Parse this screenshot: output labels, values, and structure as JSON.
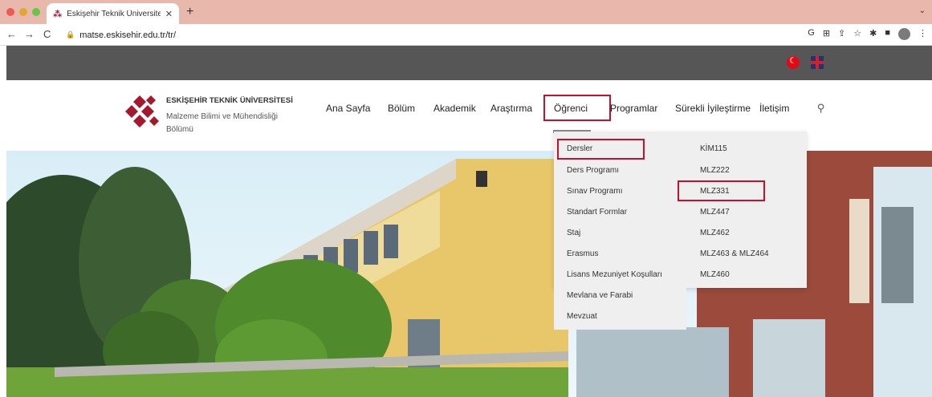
{
  "browser": {
    "tab_title": "Eskişehir Teknik Üniversitesi -",
    "url": "matse.eskisehir.edu.tr/tr/"
  },
  "site": {
    "university": "ESKİŞEHİR TEKNİK ÜNİVERSİTESİ",
    "department": "Malzeme Bilimi ve Mühendisliği Bölümü",
    "menu": [
      "Ana Sayfa",
      "Bölüm",
      "Akademik",
      "Araştırma",
      "Öğrenci",
      "Programlar",
      "Sürekli İyileştirme",
      "İletişim"
    ]
  },
  "dropdown": {
    "left": [
      "Dersler",
      "Ders Programı",
      "Sınav Programı",
      "Standart Formlar",
      "Staj",
      "Erasmus",
      "Lisans Mezuniyet Koşulları",
      "Mevlana ve Farabi",
      "Mevzuat"
    ],
    "right": [
      "KİM115",
      "MLZ222",
      "MLZ331",
      "MLZ447",
      "MLZ462",
      "MLZ463 & MLZ464",
      "MLZ460"
    ]
  },
  "colors": {
    "highlight": "#c8102e",
    "brand": "#a3192e",
    "topbar": "#565656"
  }
}
